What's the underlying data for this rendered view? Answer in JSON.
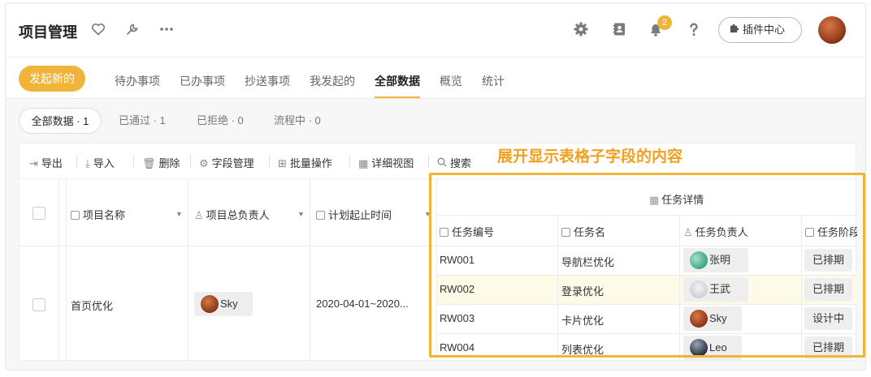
{
  "header": {
    "title": "项目管理",
    "notification_count": "2",
    "plugin_label": "插件中心"
  },
  "actions": {
    "new_label": "发起新的"
  },
  "tabs": [
    "待办事项",
    "已办事项",
    "抄送事项",
    "我发起的",
    "全部数据",
    "概览",
    "统计"
  ],
  "filters": [
    "全部数据 · 1",
    "已通过 · 1",
    "已拒绝 · 0",
    "流程中 · 0"
  ],
  "toolbar": {
    "export": "导出",
    "import": "导入",
    "delete": "删除",
    "fields": "字段管理",
    "batch": "批量操作",
    "detail_view": "详细视图",
    "search": "搜索"
  },
  "annotation": "展开显示表格子字段的内容",
  "table": {
    "columns": {
      "name": "项目名称",
      "owner": "项目总负责人",
      "period": "计划起止时间",
      "group": "任务详情",
      "task_id": "任务编号",
      "task_name": "任务名",
      "task_owner": "任务负责人",
      "task_stage": "任务阶段"
    },
    "row": {
      "name": "首页优化",
      "owner": "Sky",
      "period": "2020-04-01~2020..."
    },
    "subrows": [
      {
        "id": "RW001",
        "name": "导航栏优化",
        "owner": "张明",
        "stage": "已排期"
      },
      {
        "id": "RW002",
        "name": "登录优化",
        "owner": "王武",
        "stage": "已排期"
      },
      {
        "id": "RW003",
        "name": "卡片优化",
        "owner": "Sky",
        "stage": "设计中"
      },
      {
        "id": "RW004",
        "name": "列表优化",
        "owner": "Leo",
        "stage": "已排期"
      }
    ]
  },
  "colors": {
    "accent": "#f0b43a",
    "annotation": "#f0a020"
  },
  "icons": [
    "heart-icon",
    "wrench-icon",
    "more-icon",
    "gear-icon",
    "contacts-icon",
    "bell-icon",
    "help-icon",
    "puzzle-icon"
  ]
}
